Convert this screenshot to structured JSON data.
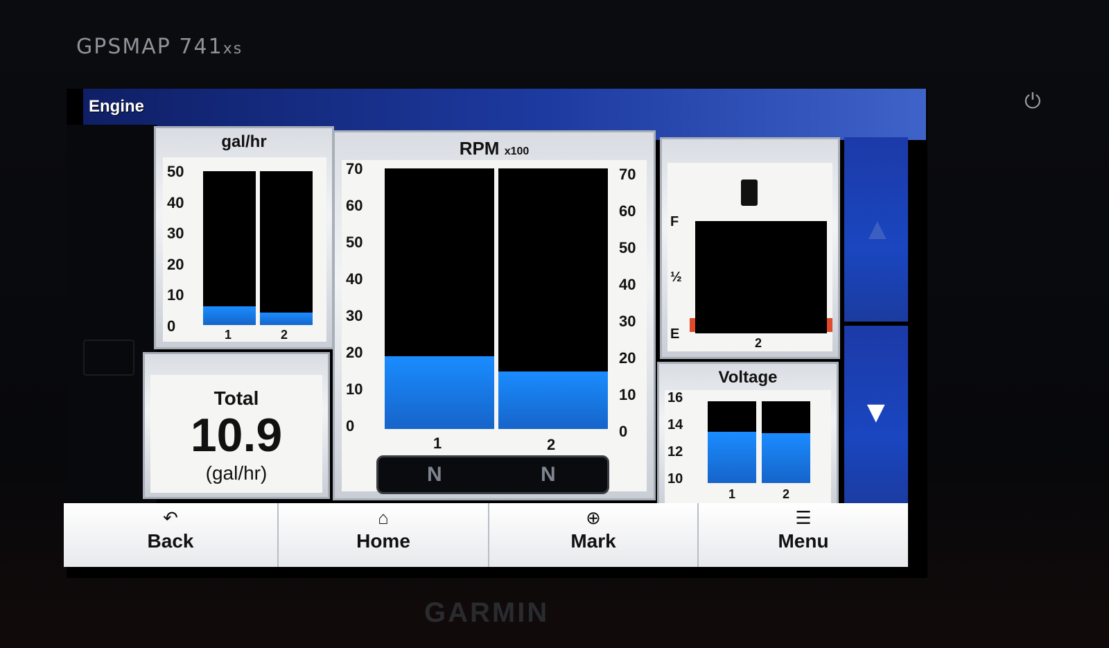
{
  "device": {
    "model_main": "GPSMAP 741",
    "model_suffix": "xs",
    "brand": "GARMIN",
    "power_icon": "power-icon"
  },
  "screen": {
    "title": "Engine"
  },
  "fuel_flow": {
    "title": "gal/hr",
    "ticks": [
      "50",
      "40",
      "30",
      "20",
      "10",
      "0"
    ],
    "engines": [
      "1",
      "2"
    ],
    "levels_fraction": [
      0.12,
      0.08
    ]
  },
  "total": {
    "label": "Total",
    "value": "10.9",
    "unit": "(gal/hr)"
  },
  "rpm": {
    "title": "RPM",
    "title_suffix": "x100",
    "ticks_left": [
      "70",
      "60",
      "50",
      "40",
      "30",
      "20",
      "10",
      "0"
    ],
    "ticks_right": [
      "70",
      "60",
      "50",
      "40",
      "30",
      "20",
      "10",
      "0"
    ],
    "engines": [
      "1",
      "2"
    ],
    "levels_fraction": [
      0.28,
      0.22
    ],
    "gears": [
      "N",
      "N"
    ]
  },
  "fuel_tank": {
    "icon": "fuel-pump-icon",
    "labels": [
      "F",
      "½",
      "E"
    ],
    "tank": "2",
    "level_fraction": 0.0
  },
  "voltage": {
    "title": "Voltage",
    "ticks": [
      "16",
      "14",
      "12",
      "10"
    ],
    "engines": [
      "1",
      "2"
    ],
    "levels_fraction": [
      0.63,
      0.61
    ]
  },
  "scroll": {
    "up_icon": "up-arrow-icon",
    "down_icon": "down-arrow-icon"
  },
  "toolbar": {
    "back": {
      "label": "Back",
      "icon": "back-arrow-icon"
    },
    "home": {
      "label": "Home",
      "icon": "home-icon"
    },
    "mark": {
      "label": "Mark",
      "icon": "crosshair-icon"
    },
    "menu": {
      "label": "Menu",
      "icon": "menu-icon"
    }
  }
}
